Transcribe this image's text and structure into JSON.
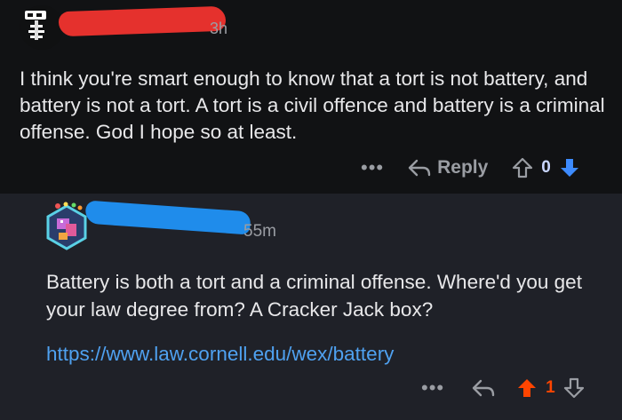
{
  "comments": [
    {
      "time": "3h",
      "body": "I think you're smart enough to know that a tort is not battery, and battery is not a tort.  A tort is a civil offence and battery is a criminal offense. God I hope so at least.",
      "more": "•••",
      "reply_label": "Reply",
      "score": "0"
    },
    {
      "time": "55m",
      "body": "Battery is both a tort and a criminal offense. Where'd you get your law degree from? A Cracker Jack box?",
      "link": "https://www.law.cornell.edu/wex/battery",
      "more": "•••",
      "score": "1"
    }
  ],
  "colors": {
    "background": "#111214",
    "reply_background": "#1f2128",
    "redaction_red": "#e5312d",
    "redaction_blue": "#1f8ceb",
    "link": "#4fa1f0",
    "upvote_active": "#ff4500",
    "downvote_active": "#3d8bff"
  },
  "icons": [
    "skeleton-avatar-icon",
    "pixel-avatar-icon",
    "reply-arrow-icon",
    "upvote-arrow-icon",
    "downvote-arrow-icon",
    "more-dots-icon"
  ]
}
